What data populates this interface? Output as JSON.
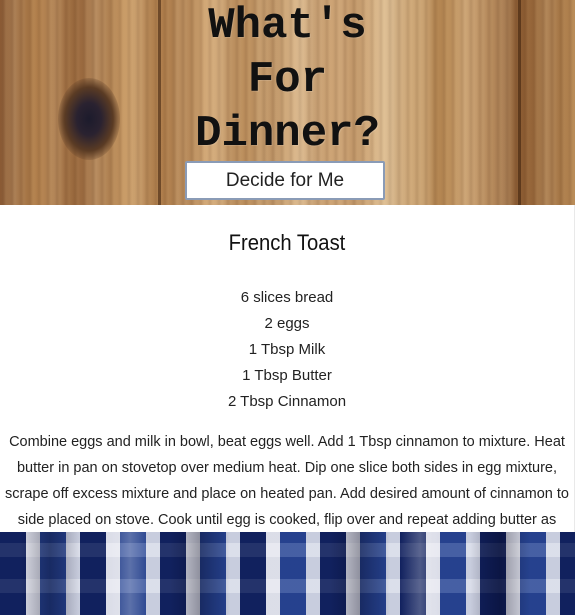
{
  "header": {
    "title_lines": [
      "What's",
      "For",
      "Dinner?"
    ],
    "decide_button_label": "Decide for Me"
  },
  "recipe": {
    "name": "French Toast",
    "ingredients": [
      "6 slices bread",
      "2 eggs",
      "1 Tbsp Milk",
      "1 Tbsp Butter",
      "2 Tbsp Cinnamon"
    ],
    "instructions": "Combine eggs and milk in bowl, beat eggs well. Add 1 Tbsp cinnamon to mixture. Heat butter in pan on stovetop over medium heat. Dip one slice both sides in egg mixture, scrape off excess mixture and place on heated pan. Add desired amount of cinnamon to side placed on stove. Cook until egg is cooked, flip over and repeat adding butter as needed."
  },
  "colors": {
    "button_border": "#8a9bb6",
    "card_background": "#ffffff",
    "text": "#222222"
  }
}
